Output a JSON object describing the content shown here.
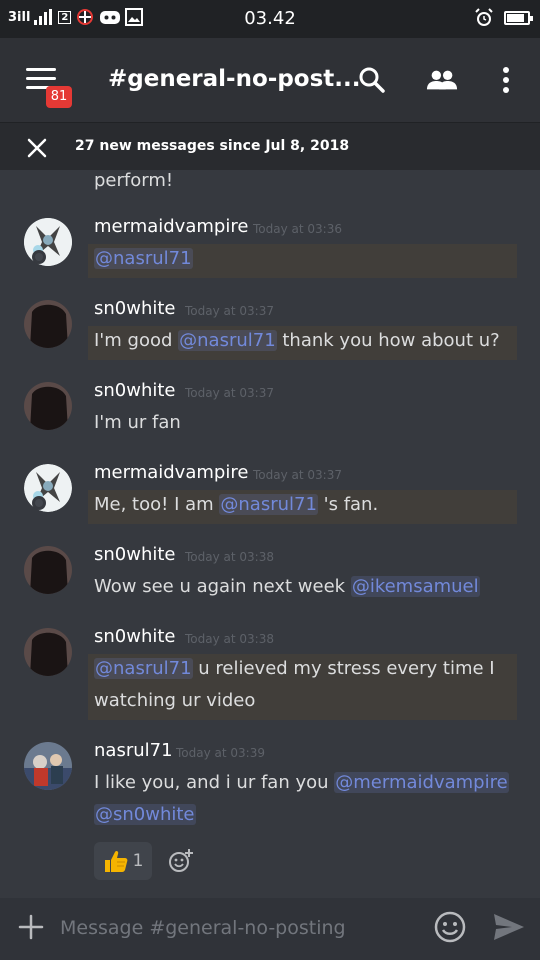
{
  "status_bar": {
    "left_text_1": "3ill",
    "left_text_2": "all",
    "sim_label": "2",
    "time": "03.42",
    "battery_level": 0.85
  },
  "header": {
    "menu_badge": "81",
    "channel_title": "#general-no-post..."
  },
  "new_messages": {
    "text": "27 new messages since Jul 8, 2018"
  },
  "messages": {
    "partial_line": "perform!",
    "m1": {
      "author": "mermaidvampire",
      "time": "Today at 03:36",
      "mention": "@nasrul71"
    },
    "m2": {
      "author": "sn0white",
      "time": "Today at 03:37",
      "pre": "I'm good ",
      "mention": "@nasrul71",
      "post": " thank you  how about u?"
    },
    "m3": {
      "author": "sn0white",
      "time": "Today at 03:37",
      "text": "I'm ur fan"
    },
    "m4": {
      "author": "mermaidvampire",
      "time": "Today at 03:37",
      "pre": "Me, too! I am ",
      "mention": "@nasrul71",
      "post": " 's fan."
    },
    "m5": {
      "author": "sn0white",
      "time": "Today at 03:38",
      "pre": "Wow see u again next week ",
      "mention": "@ikemsamuel"
    },
    "m6": {
      "author": "sn0white",
      "time": "Today at 03:38",
      "mention": "@nasrul71",
      "post": " u relieved my stress every time I",
      "line2": "watching ur video"
    },
    "m7": {
      "author": "nasrul71",
      "time": "Today at 03:39",
      "pre": "I like you, and i ur fan you ",
      "mention1": "@mermaidvampire",
      "mention2": "@sn0white",
      "reaction_count": "1"
    }
  },
  "composer": {
    "placeholder": "Message #general-no-posting"
  },
  "icons": [
    "menu-icon",
    "search-icon",
    "members-icon",
    "more-icon",
    "close-icon",
    "add-reaction-icon",
    "plus-icon",
    "emoji-icon",
    "send-icon",
    "thumbs-up-icon"
  ],
  "colors": {
    "accent": "#7289da",
    "badge": "#e53935",
    "background": "#36393f"
  }
}
